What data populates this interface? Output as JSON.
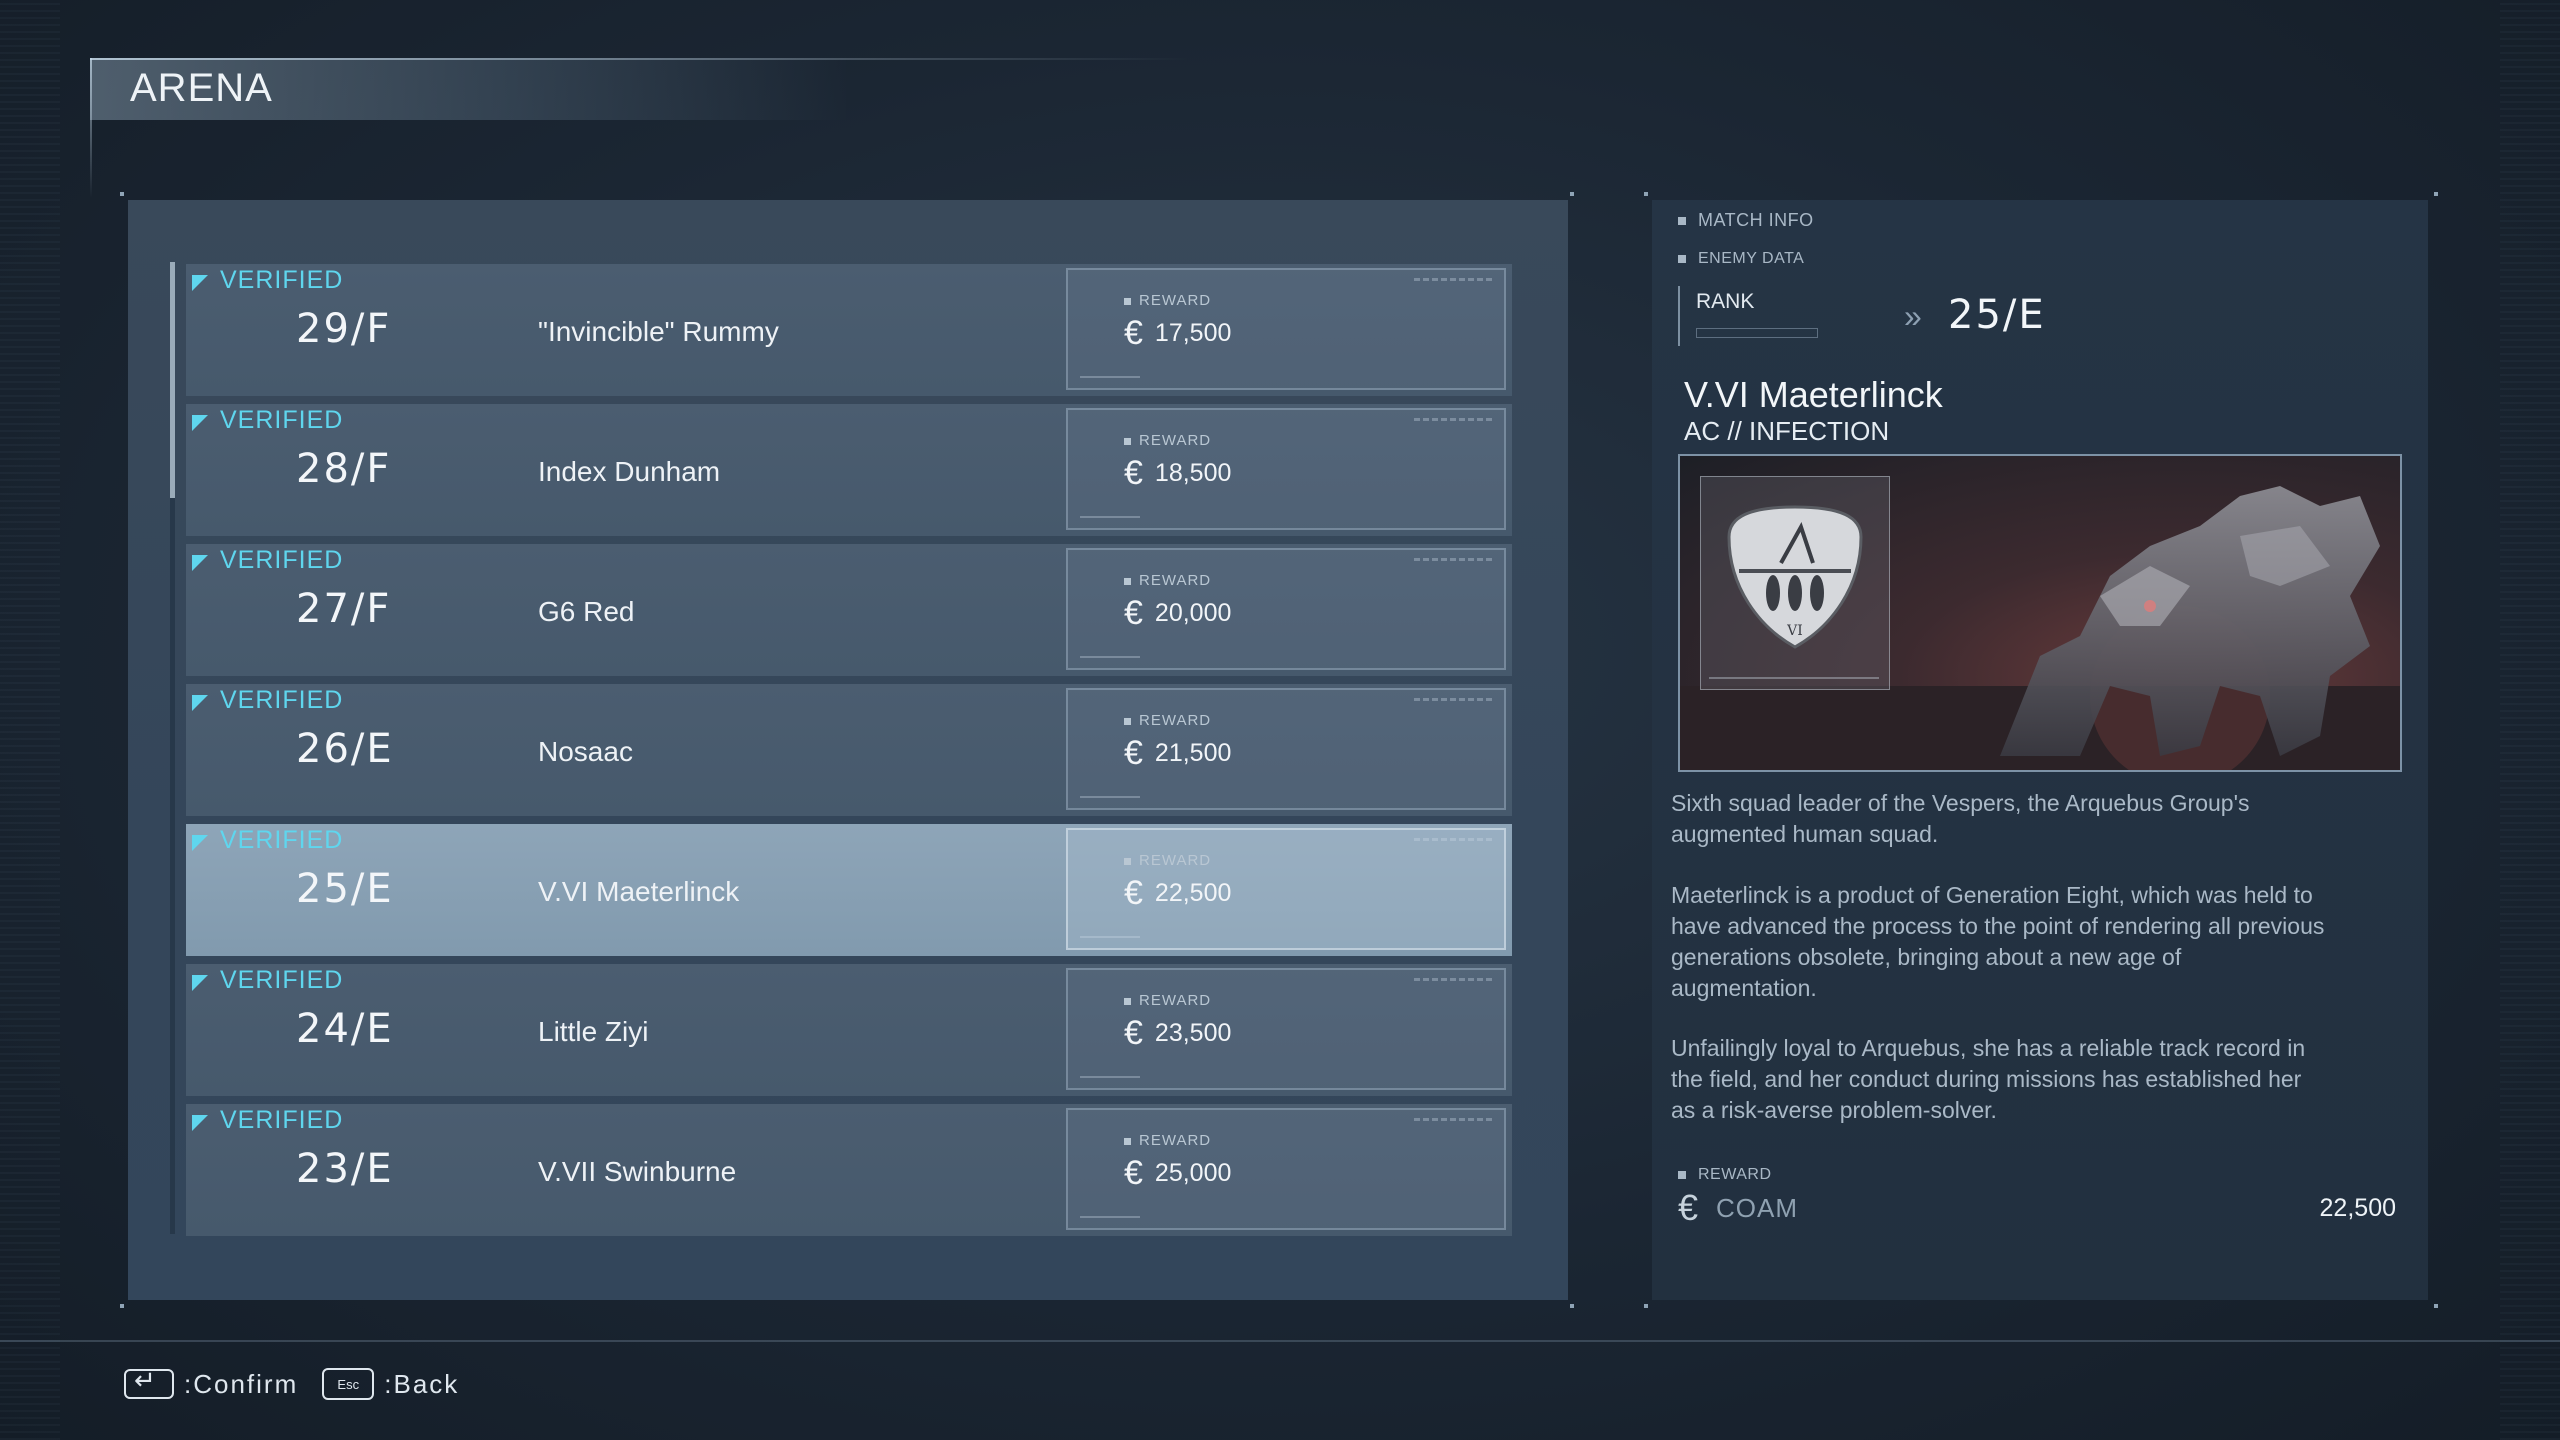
{
  "title": "ARENA",
  "list": {
    "status_label": "VERIFIED",
    "reward_label": "REWARD",
    "currency_symbol": "€",
    "rows": [
      {
        "rank": "29/F",
        "pilot": "\"Invincible\" Rummy",
        "reward": "17,500"
      },
      {
        "rank": "28/F",
        "pilot": "Index Dunham",
        "reward": "18,500"
      },
      {
        "rank": "27/F",
        "pilot": "G6 Red",
        "reward": "20,000"
      },
      {
        "rank": "26/E",
        "pilot": "Nosaac",
        "reward": "21,500"
      },
      {
        "rank": "25/E",
        "pilot": "V.VI Maeterlinck",
        "reward": "22,500",
        "selected": true
      },
      {
        "rank": "24/E",
        "pilot": "Little Ziyi",
        "reward": "23,500"
      },
      {
        "rank": "23/E",
        "pilot": "V.VII Swinburne",
        "reward": "25,000"
      }
    ]
  },
  "info": {
    "match_info_label": "MATCH INFO",
    "enemy_data_label": "ENEMY DATA",
    "rank_label": "RANK",
    "rank_arrow": "»",
    "rank_value": "25/E",
    "enemy_name": "V.VI Maeterlinck",
    "enemy_type": "AC // INFECTION",
    "emblem_text": "VI",
    "descriptions": [
      "Sixth squad leader of the Vespers, the Arquebus Group's augmented human squad.",
      "Maeterlinck is a product of Generation Eight, which was held to have advanced the process to the point of rendering all previous generations obsolete, bringing about a new age of augmentation.",
      "Unfailingly loyal to Arquebus, she has a reliable track record in the field, and her conduct during missions has established her as a risk-averse problem-solver."
    ],
    "reward_label": "REWARD",
    "currency_symbol": "€",
    "currency_name": "COAM",
    "reward_amount": "22,500"
  },
  "footer": {
    "confirm_label": ":Confirm",
    "esc_key": "Esc",
    "back_label": ":Back"
  }
}
